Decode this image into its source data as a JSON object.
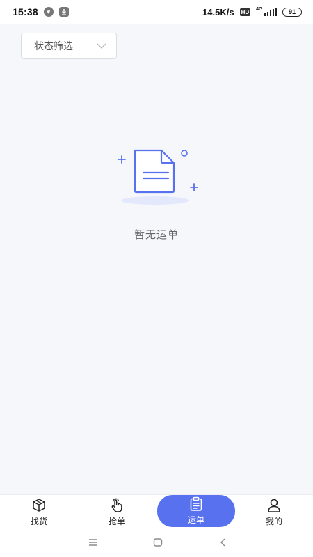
{
  "status_bar": {
    "time": "15:38",
    "net_speed": "14.5K/s",
    "hd": "HD",
    "network": "4G",
    "battery": "91"
  },
  "filter": {
    "label": "状态筛选",
    "icon": "chevron-down-icon"
  },
  "empty_state": {
    "icon": "empty-document-icon",
    "text": "暂无运单"
  },
  "tabs": [
    {
      "label": "找货",
      "icon": "package-box-icon",
      "active": false
    },
    {
      "label": "抢单",
      "icon": "tap-hand-icon",
      "active": false
    },
    {
      "label": "运单",
      "icon": "clipboard-icon",
      "active": true
    },
    {
      "label": "我的",
      "icon": "user-icon",
      "active": false
    }
  ],
  "nav": [
    "menu-icon",
    "home-square-icon",
    "back-icon"
  ],
  "colors": {
    "accent": "#5871ee",
    "background": "#f6f7fb",
    "illustration_shadow": "#e4e8fc"
  }
}
